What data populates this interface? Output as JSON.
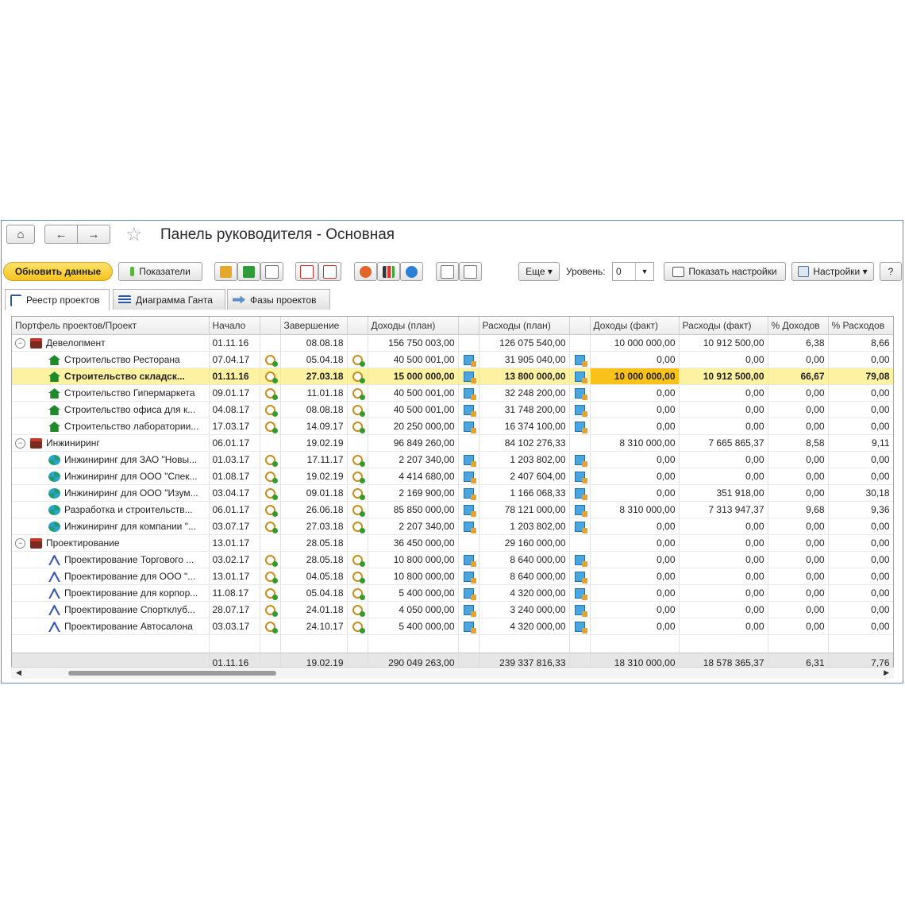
{
  "window": {
    "title": "Панель руководителя - Основная",
    "star": "☆"
  },
  "nav": {
    "home": "⌂",
    "back": "←",
    "forward": "→"
  },
  "toolbar": {
    "refresh": "Обновить данные",
    "indicators": "Показатели",
    "more": "Еще ▾",
    "level_label": "Уровень:",
    "level_value": "0",
    "show_settings": "Показать настройки",
    "settings": "Настройки ▾",
    "help": "?"
  },
  "tabs": [
    "Реестр проектов",
    "Диаграмма Ганта",
    "Фазы проектов"
  ],
  "columns": [
    "Портфель проектов/Проект",
    "Начало",
    "Завершение",
    "Доходы (план)",
    "Расходы (план)",
    "Доходы (факт)",
    "Расходы (факт)",
    "% Доходов",
    "% Расходов"
  ],
  "rows": [
    {
      "kind": "group",
      "icon": "briefcase",
      "name": "Девелопмент",
      "start": "01.11.16",
      "end": "08.08.18",
      "inc_plan": "156 750 003,00",
      "exp_plan": "126 075 540,00",
      "inc_fact": "10 000 000,00",
      "exp_fact": "10 912 500,00",
      "pct_inc": "6,38",
      "pct_exp": "8,66"
    },
    {
      "kind": "item",
      "icon": "house",
      "name": "Строительство Ресторана",
      "start": "07.04.17",
      "end": "05.04.18",
      "inc_plan": "40 500 001,00",
      "exp_plan": "31 905 040,00",
      "inc_fact": "0,00",
      "exp_fact": "0,00",
      "pct_inc": "0,00",
      "pct_exp": "0,00"
    },
    {
      "kind": "item",
      "icon": "house",
      "selected": true,
      "name": "Строительство складск...",
      "start": "01.11.16",
      "end": "27.03.18",
      "inc_plan": "15 000 000,00",
      "exp_plan": "13 800 000,00",
      "inc_fact": "10 000 000,00",
      "exp_fact": "10 912 500,00",
      "pct_inc": "66,67",
      "pct_exp": "79,08"
    },
    {
      "kind": "item",
      "icon": "house",
      "name": "Строительство Гипермаркета",
      "start": "09.01.17",
      "end": "11.01.18",
      "inc_plan": "40 500 001,00",
      "exp_plan": "32 248 200,00",
      "inc_fact": "0,00",
      "exp_fact": "0,00",
      "pct_inc": "0,00",
      "pct_exp": "0,00"
    },
    {
      "kind": "item",
      "icon": "house",
      "name": "Строительство офиса для к...",
      "start": "04.08.17",
      "end": "08.08.18",
      "inc_plan": "40 500 001,00",
      "exp_plan": "31 748 200,00",
      "inc_fact": "0,00",
      "exp_fact": "0,00",
      "pct_inc": "0,00",
      "pct_exp": "0,00"
    },
    {
      "kind": "item",
      "icon": "house",
      "name": "Строительство лаборатории...",
      "start": "17.03.17",
      "end": "14.09.17",
      "inc_plan": "20 250 000,00",
      "exp_plan": "16 374 100,00",
      "inc_fact": "0,00",
      "exp_fact": "0,00",
      "pct_inc": "0,00",
      "pct_exp": "0,00"
    },
    {
      "kind": "group",
      "icon": "briefcase",
      "name": "Инжиниринг",
      "start": "06.01.17",
      "end": "19.02.19",
      "inc_plan": "96 849 260,00",
      "exp_plan": "84 102 276,33",
      "inc_fact": "8 310 000,00",
      "exp_fact": "7 665 865,37",
      "pct_inc": "8,58",
      "pct_exp": "9,11"
    },
    {
      "kind": "item",
      "icon": "gear",
      "name": "Инжиниринг для ЗАО \"Новы...",
      "start": "01.03.17",
      "end": "17.11.17",
      "inc_plan": "2 207 340,00",
      "exp_plan": "1 203 802,00",
      "inc_fact": "0,00",
      "exp_fact": "0,00",
      "pct_inc": "0,00",
      "pct_exp": "0,00"
    },
    {
      "kind": "item",
      "icon": "gear",
      "name": "Инжиниринг для ООО \"Спек...",
      "start": "01.08.17",
      "end": "19.02.19",
      "inc_plan": "4 414 680,00",
      "exp_plan": "2 407 604,00",
      "inc_fact": "0,00",
      "exp_fact": "0,00",
      "pct_inc": "0,00",
      "pct_exp": "0,00"
    },
    {
      "kind": "item",
      "icon": "gear",
      "name": "Инжиниринг для ООО \"Изум...",
      "start": "03.04.17",
      "end": "09.01.18",
      "inc_plan": "2 169 900,00",
      "exp_plan": "1 166 068,33",
      "inc_fact": "0,00",
      "exp_fact": "351 918,00",
      "pct_inc": "0,00",
      "pct_exp": "30,18"
    },
    {
      "kind": "item",
      "icon": "gear",
      "name": "Разработка и строительств...",
      "start": "06.01.17",
      "end": "26.06.18",
      "inc_plan": "85 850 000,00",
      "exp_plan": "78 121 000,00",
      "inc_fact": "8 310 000,00",
      "exp_fact": "7 313 947,37",
      "pct_inc": "9,68",
      "pct_exp": "9,36"
    },
    {
      "kind": "item",
      "icon": "gear",
      "name": "Инжиниринг для компании \"...",
      "start": "03.07.17",
      "end": "27.03.18",
      "inc_plan": "2 207 340,00",
      "exp_plan": "1 203 802,00",
      "inc_fact": "0,00",
      "exp_fact": "0,00",
      "pct_inc": "0,00",
      "pct_exp": "0,00"
    },
    {
      "kind": "group",
      "icon": "briefcase",
      "name": "Проектирование",
      "start": "13.01.17",
      "end": "28.05.18",
      "inc_plan": "36 450 000,00",
      "exp_plan": "29 160 000,00",
      "inc_fact": "0,00",
      "exp_fact": "0,00",
      "pct_inc": "0,00",
      "pct_exp": "0,00"
    },
    {
      "kind": "item",
      "icon": "compass",
      "name": "Проектирование Торгового ...",
      "start": "03.02.17",
      "end": "28.05.18",
      "inc_plan": "10 800 000,00",
      "exp_plan": "8 640 000,00",
      "inc_fact": "0,00",
      "exp_fact": "0,00",
      "pct_inc": "0,00",
      "pct_exp": "0,00"
    },
    {
      "kind": "item",
      "icon": "compass",
      "name": "Проектирование для ООО \"...",
      "start": "13.01.17",
      "end": "04.05.18",
      "inc_plan": "10 800 000,00",
      "exp_plan": "8 640 000,00",
      "inc_fact": "0,00",
      "exp_fact": "0,00",
      "pct_inc": "0,00",
      "pct_exp": "0,00"
    },
    {
      "kind": "item",
      "icon": "compass",
      "name": "Проектирование для корпор...",
      "start": "11.08.17",
      "end": "05.04.18",
      "inc_plan": "5 400 000,00",
      "exp_plan": "4 320 000,00",
      "inc_fact": "0,00",
      "exp_fact": "0,00",
      "pct_inc": "0,00",
      "pct_exp": "0,00"
    },
    {
      "kind": "item",
      "icon": "compass",
      "name": "Проектирование Спортклуб...",
      "start": "28.07.17",
      "end": "24.01.18",
      "inc_plan": "4 050 000,00",
      "exp_plan": "3 240 000,00",
      "inc_fact": "0,00",
      "exp_fact": "0,00",
      "pct_inc": "0,00",
      "pct_exp": "0,00"
    },
    {
      "kind": "item",
      "icon": "compass",
      "name": "Проектирование Автосалона",
      "start": "03.03.17",
      "end": "24.10.17",
      "inc_plan": "5 400 000,00",
      "exp_plan": "4 320 000,00",
      "inc_fact": "0,00",
      "exp_fact": "0,00",
      "pct_inc": "0,00",
      "pct_exp": "0,00"
    }
  ],
  "totals": {
    "start": "01.11.16",
    "end": "19.02.19",
    "inc_plan": "290 049 263,00",
    "exp_plan": "239 337 816,33",
    "inc_fact": "18 310 000,00",
    "exp_fact": "18 578 365,37",
    "pct_inc": "6,31",
    "pct_exp": "7,76"
  },
  "colors": {
    "accent": "#f6c21f",
    "selection": "#fdf1a2",
    "highlight": "#f8c21b",
    "border": "#5a8fc7"
  }
}
